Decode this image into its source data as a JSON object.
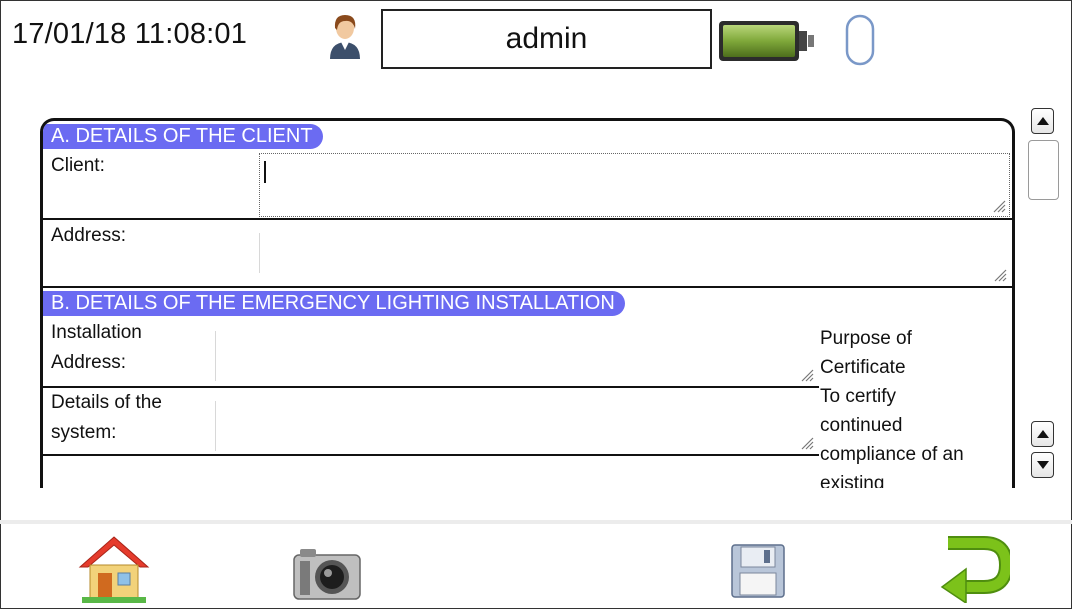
{
  "header": {
    "datetime": "17/01/18 11:08:01",
    "user": "admin",
    "icons": [
      "user-avatar-icon",
      "battery-icon",
      "connection-status-icon"
    ]
  },
  "form": {
    "section_a": {
      "title": "A. DETAILS OF THE CLIENT",
      "client_label": "Client:",
      "address_label": "Address:"
    },
    "section_b": {
      "title": "B. DETAILS OF THE EMERGENCY LIGHTING INSTALLATION",
      "installation_address_label_line1": "Installation",
      "installation_address_label_line2": "Address:",
      "details_system_label_line1": "Details of the",
      "details_system_label_line2": "system:",
      "purpose_text": [
        "Purpose of",
        "Certificate",
        "To certify",
        "continued",
        "compliance of an",
        "existing"
      ]
    }
  },
  "toolbar": {
    "icons": [
      "home-icon",
      "camera-icon",
      "save-icon",
      "return-icon"
    ]
  },
  "colors": {
    "section_header": "#6b6bf2",
    "battery": "#7fa83a",
    "return_arrow": "#7cc21a",
    "home_roof": "#e53b2c"
  }
}
